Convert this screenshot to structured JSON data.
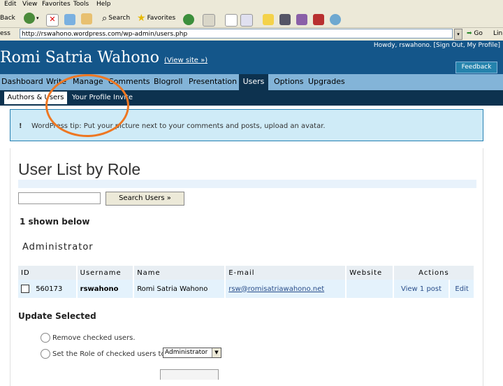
{
  "ie": {
    "menu": [
      "Edit",
      "View",
      "Favorites",
      "Tools",
      "Help"
    ],
    "toolbar": {
      "back": "Back",
      "search": "Search",
      "favorites": "Favorites"
    },
    "address": "http://rswahono.wordpress.com/wp-admin/users.php",
    "go": "Go",
    "links": "Lin",
    "address_label": "ess"
  },
  "wp": {
    "blog_title": "Romi Satria Wahono",
    "view_site": "(View site »)",
    "howdy": "Howdy, rswahono. [Sign Out, My Profile]",
    "feedback": "Feedback",
    "nav": [
      "Dashboard",
      "Write",
      "Manage",
      "Comments",
      "Blogroll",
      "Presentation",
      "Users",
      "Options",
      "Upgrades"
    ],
    "subnav": [
      "Authors & Users",
      "Your Profile",
      "Invite"
    ],
    "notice_icon": "!",
    "notice": "WordPress tip: Put your picture next to your comments and posts, upload an avatar.",
    "page_title": "User List by Role",
    "search_button": "Search Users »",
    "shown_below": "1 shown below",
    "role_heading": "Administrator",
    "table": {
      "headers": [
        "ID",
        "Username",
        "Name",
        "E-mail",
        "Website",
        "Actions"
      ],
      "rows": [
        {
          "id": "560173",
          "username": "rswahono",
          "name": "Romi Satria Wahono",
          "email": "rsw@romisatriawahono.net",
          "website": "",
          "view": "View 1 post",
          "edit": "Edit"
        }
      ]
    },
    "update_heading": "Update Selected",
    "remove_label": "Remove checked users.",
    "setrole_label": "Set the Role of checked users to:",
    "role_selected": "Administrator"
  }
}
